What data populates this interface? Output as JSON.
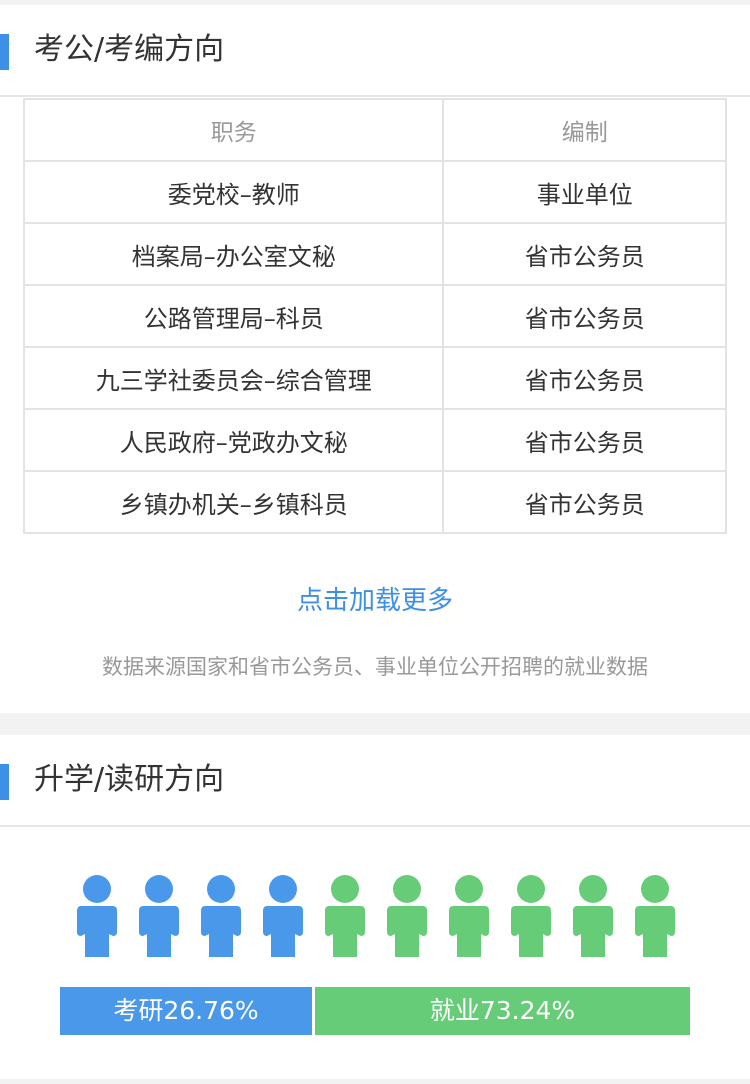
{
  "sections": {
    "exam": {
      "title": "考公/考编方向",
      "table": {
        "headers": [
          "职务",
          "编制"
        ],
        "rows": [
          [
            "委党校–教师",
            "事业单位"
          ],
          [
            "档案局–办公室文秘",
            "省市公务员"
          ],
          [
            "公路管理局–科员",
            "省市公务员"
          ],
          [
            "九三学社委员会–综合管理",
            "省市公务员"
          ],
          [
            "人民政府–党政办文秘",
            "省市公务员"
          ],
          [
            "乡镇办机关–乡镇科员",
            "省市公务员"
          ]
        ]
      },
      "load_more": "点击加载更多",
      "source_note": "数据来源国家和省市公务员、事业单位公开招聘的就业数据"
    },
    "further": {
      "title": "升学/读研方向",
      "people": {
        "total": 10,
        "graduate_count": 4
      },
      "bars": {
        "graduate_label": "考研26.76%",
        "graduate_value": 26.76,
        "employment_label": "就业73.24%",
        "employment_value": 73.24
      }
    }
  },
  "colors": {
    "accent": "#3e8fe6",
    "graduate": "#4a98ea",
    "employment": "#66cc77"
  }
}
